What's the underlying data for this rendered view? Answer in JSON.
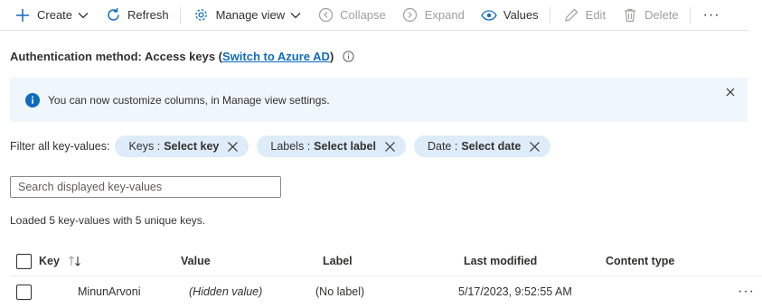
{
  "toolbar": {
    "create": "Create",
    "refresh": "Refresh",
    "manage_view": "Manage view",
    "collapse": "Collapse",
    "expand": "Expand",
    "values": "Values",
    "edit": "Edit",
    "delete": "Delete",
    "more": "···"
  },
  "auth": {
    "label": "Authentication method: Access keys (",
    "link": "Switch to Azure AD",
    "suffix": ")"
  },
  "banner": {
    "message": "You can now customize columns, in Manage view settings."
  },
  "filters": {
    "label": "Filter all key-values:",
    "pills": [
      {
        "name": "Keys",
        "value": "Select key"
      },
      {
        "name": "Labels",
        "value": "Select label"
      },
      {
        "name": "Date",
        "value": "Select date"
      }
    ]
  },
  "search": {
    "placeholder": "Search displayed key-values",
    "value": ""
  },
  "status": {
    "loaded": "Loaded 5 key-values with 5 unique keys."
  },
  "table": {
    "columns": {
      "key": "Key",
      "value": "Value",
      "label": "Label",
      "last_modified": "Last modified",
      "content_type": "Content type"
    },
    "rows": [
      {
        "key": "MinunArvoni",
        "value": "(Hidden value)",
        "label": "(No label)",
        "last_modified": "5/17/2023, 9:52:55 AM",
        "content_type": "",
        "more": "···"
      }
    ]
  },
  "colors": {
    "accent": "#0f6cbd",
    "banner_bg": "#eff6fc",
    "pill_bg": "#deecf9",
    "disabled": "#a19f9d"
  }
}
